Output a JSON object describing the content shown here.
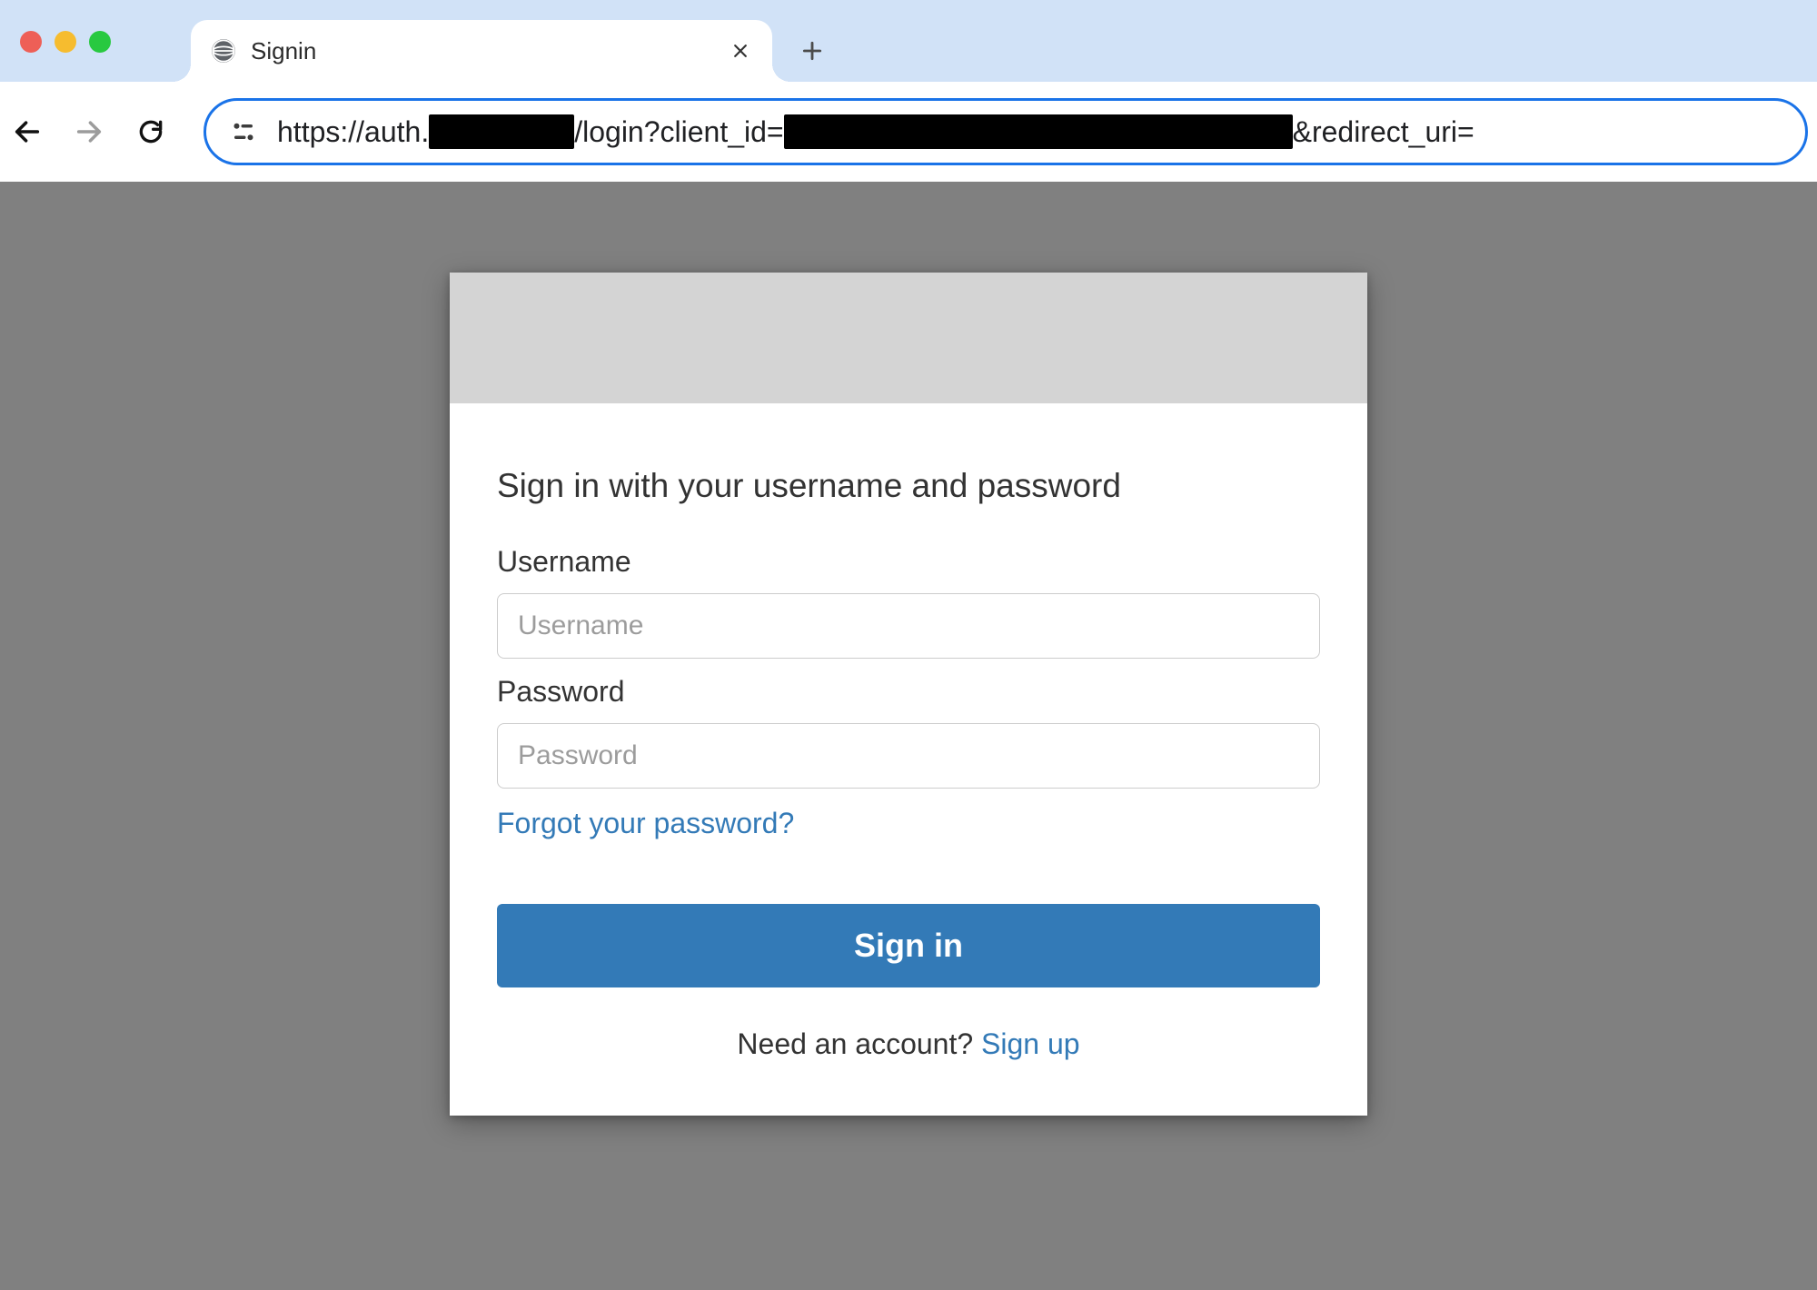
{
  "browser": {
    "tab_title": "Signin",
    "url_prefix": "https://auth.",
    "url_mid": "/login?client_id=",
    "url_suffix_visible": "&redirect_uri="
  },
  "login": {
    "heading": "Sign in with your username and password",
    "username_label": "Username",
    "username_placeholder": "Username",
    "password_label": "Password",
    "password_placeholder": "Password",
    "forgot_link": "Forgot your password?",
    "signin_button": "Sign in",
    "need_account_text": "Need an account? ",
    "signup_link": "Sign up"
  },
  "colors": {
    "accent": "#337ab7",
    "browser_frame": "#d1e2f7",
    "page_bg": "#808080"
  }
}
